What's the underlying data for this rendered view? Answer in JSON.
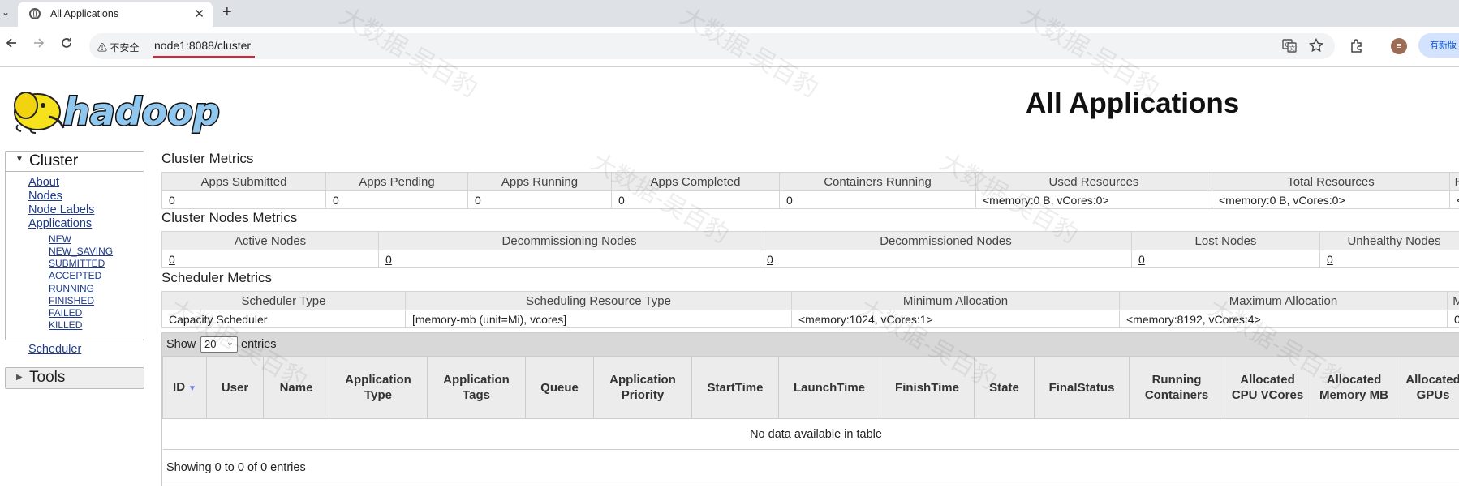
{
  "browser": {
    "tab_title": "All Applications",
    "close_glyph": "✕",
    "new_tab_glyph": "+",
    "insecure_label": "⚠ 不安全",
    "url": "node1:8088/cluster",
    "avatar_letter": "≡",
    "update_label": "有新版",
    "icons": [
      "tab-search-icon",
      "globe-icon",
      "close-icon",
      "plus-icon",
      "back-icon",
      "forward-icon",
      "reload-icon",
      "translate-icon",
      "star-icon",
      "extensions-icon"
    ]
  },
  "page": {
    "title": "All Applications",
    "logo_text": "hadoop"
  },
  "sidebar": {
    "cluster_label": "Cluster",
    "links": [
      "About",
      "Nodes",
      "Node Labels",
      "Applications"
    ],
    "app_states": [
      "NEW",
      "NEW_SAVING",
      "SUBMITTED",
      "ACCEPTED",
      "RUNNING",
      "FINISHED",
      "FAILED",
      "KILLED"
    ],
    "scheduler_label": "Scheduler",
    "tools_label": "Tools"
  },
  "cluster_metrics": {
    "title": "Cluster Metrics",
    "headers": [
      "Apps Submitted",
      "Apps Pending",
      "Apps Running",
      "Apps Completed",
      "Containers Running",
      "Used Resources",
      "Total Resources",
      "R"
    ],
    "values": [
      "0",
      "0",
      "0",
      "0",
      "0",
      "<memory:0 B, vCores:0>",
      "<memory:0 B, vCores:0>",
      "<"
    ]
  },
  "nodes_metrics": {
    "title": "Cluster Nodes Metrics",
    "headers": [
      "Active Nodes",
      "Decommissioning Nodes",
      "Decommissioned Nodes",
      "Lost Nodes",
      "Unhealthy Nodes"
    ],
    "values": [
      "0",
      "0",
      "0",
      "0",
      "0"
    ]
  },
  "scheduler_metrics": {
    "title": "Scheduler Metrics",
    "headers": [
      "Scheduler Type",
      "Scheduling Resource Type",
      "Minimum Allocation",
      "Maximum Allocation",
      "M"
    ],
    "values": [
      "Capacity Scheduler",
      "[memory-mb (unit=Mi), vcores]",
      "<memory:1024, vCores:1>",
      "<memory:8192, vCores:4>",
      "0"
    ]
  },
  "apps_table": {
    "show_label": "Show",
    "page_size": "20",
    "entries_label": "entries",
    "columns": [
      "ID",
      "User",
      "Name",
      "Application Type",
      "Application Tags",
      "Queue",
      "Application Priority",
      "StartTime",
      "LaunchTime",
      "FinishTime",
      "State",
      "FinalStatus",
      "Running Containers",
      "Allocated CPU VCores",
      "Allocated Memory MB",
      "Allocated GPUs"
    ],
    "empty_message": "No data available in table",
    "info": "Showing 0 to 0 of 0 entries"
  },
  "watermark_text": "大数据-吴百豹"
}
